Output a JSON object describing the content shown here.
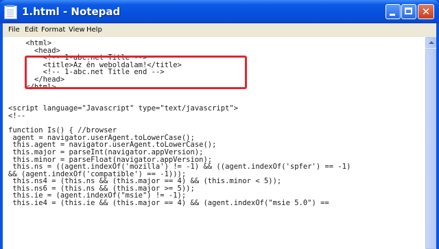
{
  "window": {
    "title": "1.html - Notepad",
    "controls": {
      "minimize": "minimize-icon",
      "maximize": "maximize-icon",
      "close": "close-icon"
    }
  },
  "menu": {
    "items": [
      "File",
      "Edit",
      "Format",
      "View",
      "Help"
    ]
  },
  "editor": {
    "lines": [
      "    <html>",
      "      <head>",
      "        <!-- 1-abc.net Title -->",
      "        <title>Az én weboldalam!</title>",
      "        <!-- 1-abc.net Title end -->",
      "      </head>",
      "    </html>",
      "",
      "",
      "<script language=\"Javascript\" type=\"text/javascript\">",
      "<!--",
      "",
      "function Is() { //browser",
      " agent = navigator.userAgent.toLowerCase();",
      " this.agent = navigator.userAgent.toLowerCase();",
      " this.major = parseInt(navigator.appVersion);",
      " this.minor = parseFloat(navigator.appVersion);",
      " this.ns = ((agent.indexOf('mozilla') != -1) && ((agent.indexOf('spfer') == -1)",
      "&& (agent.indexOf('compatible') == -1)));",
      " this.ns4 = (this.ns && (this.major == 4) && (this.minor < 5));",
      " this.ns6 = (this.ns && (this.major >= 5));",
      " this.ie = (agent.indexOf(\"msie\") != -1);",
      " this.ie4 = (this.ie && (this.major == 4) && (agent.indexOf(\"msie 5.0\") =="
    ],
    "highlight_color": "#e0262b"
  }
}
